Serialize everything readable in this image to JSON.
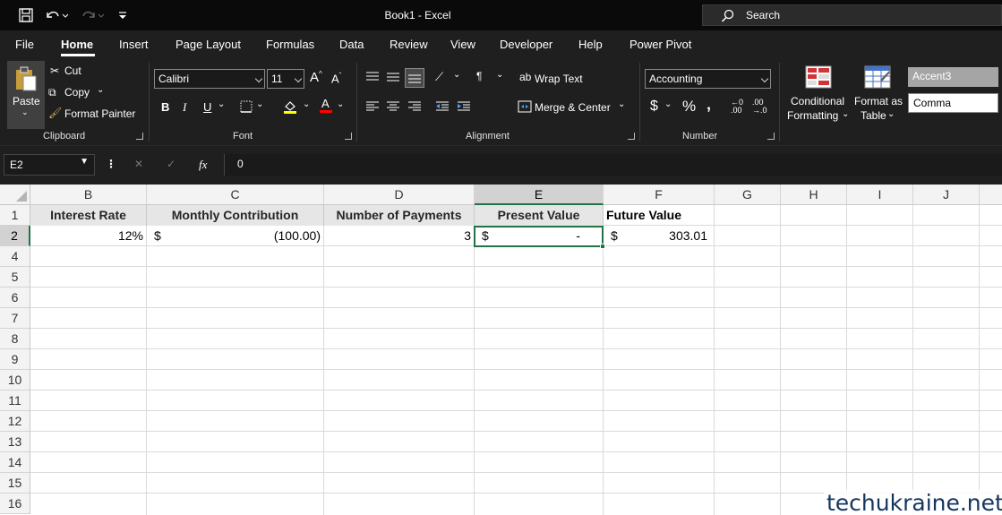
{
  "window": {
    "title": "Book1  -  Excel",
    "search_label": "Search"
  },
  "menu": {
    "tabs": [
      "File",
      "Home",
      "Insert",
      "Page Layout",
      "Formulas",
      "Data",
      "Review",
      "View",
      "Developer",
      "Help",
      "Power Pivot"
    ],
    "active": "Home"
  },
  "ribbon": {
    "clipboard": {
      "paste": "Paste",
      "cut": "Cut",
      "copy": "Copy",
      "format_painter": "Format Painter",
      "label": "Clipboard"
    },
    "font": {
      "name": "Calibri",
      "size": "11",
      "bold": "B",
      "italic": "I",
      "underline": "U",
      "label": "Font"
    },
    "alignment": {
      "wrap_text": "Wrap Text",
      "merge_center": "Merge & Center",
      "label": "Alignment"
    },
    "number": {
      "format": "Accounting",
      "currency": "$",
      "percent": "%",
      "comma": "‚",
      "label": "Number"
    },
    "styles": {
      "conditional_formatting_1": "Conditional",
      "conditional_formatting_2": "Formatting",
      "format_as_table_1": "Format as",
      "format_as_table_2": "Table",
      "accent3": "Accent3",
      "comma": "Comma"
    }
  },
  "formula_bar": {
    "name_box": "E2",
    "cancel": "✕",
    "enter": "✓",
    "fx": "fx",
    "value": "0"
  },
  "sheet": {
    "columns": [
      "B",
      "C",
      "D",
      "E",
      "F",
      "G",
      "H",
      "I",
      "J"
    ],
    "selected_column": "E",
    "rows": [
      "1",
      "2",
      "4",
      "5",
      "6",
      "7",
      "8",
      "9",
      "10",
      "11",
      "12",
      "13",
      "14",
      "15",
      "16"
    ],
    "selected_row": "2",
    "headers": {
      "B1": "Interest Rate",
      "C1": "Monthly Contribution",
      "D1": "Number of Payments",
      "E1": "Present Value",
      "F1": "Future Value"
    },
    "values": {
      "B2": "12%",
      "C2_symbol": "$",
      "C2": "(100.00)",
      "D2": "3",
      "E2_symbol": "$",
      "E2": "-",
      "F2_symbol": "$",
      "F2": "303.01"
    }
  },
  "watermark": "techukraine.net",
  "colors": {
    "excel_green": "#217346",
    "header_fill": "#e7e6e6",
    "accent3_fill": "#a5a5a5"
  }
}
